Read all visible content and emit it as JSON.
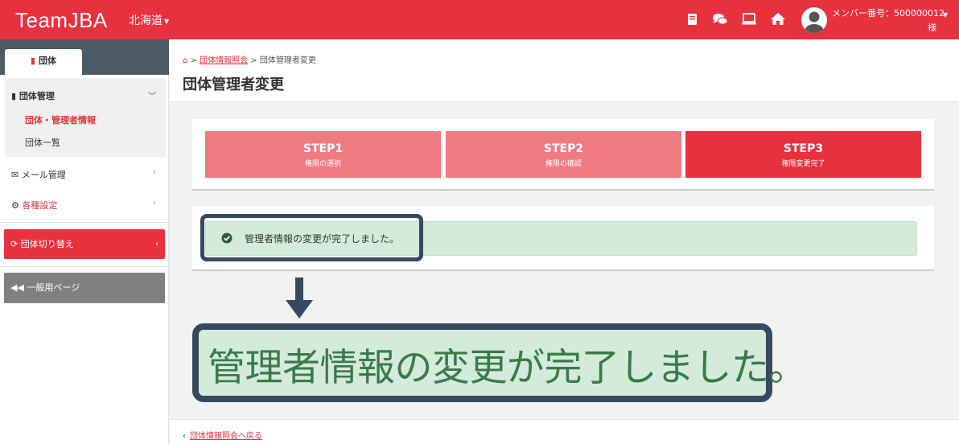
{
  "header": {
    "logo": "TeamJBA",
    "region": "北海道",
    "member_label": "メンバー番号：500000012",
    "member_suffix": "様",
    "icons": [
      "book-icon",
      "chat-icon",
      "laptop-icon",
      "home-icon",
      "user-avatar-icon"
    ],
    "color": "#e8313f"
  },
  "sidebar": {
    "tab_label": "団体",
    "group_label": "団体管理",
    "sub_items": [
      "団体・管理者情報",
      "団体一覧"
    ],
    "mail_label": "メール管理",
    "settings_label": "各種設定",
    "switch_label": "団体切り替え",
    "general_label": "一般用ページ"
  },
  "breadcrumb": {
    "link": "団体情報照会",
    "current": "団体管理者変更"
  },
  "page_title": "団体管理者変更",
  "steps": [
    {
      "title": "STEP1",
      "subtitle": "権限の選択",
      "color": "#f07a83"
    },
    {
      "title": "STEP2",
      "subtitle": "権限の確認",
      "color": "#f07a83"
    },
    {
      "title": "STEP3",
      "subtitle": "権限変更完了",
      "color": "#e8313f"
    }
  ],
  "alert_text": "管理者情報の変更が完了しました。",
  "zoom_text": "管理者情報の変更が完了しました。",
  "footer_link": "団体情報照会へ戻る"
}
